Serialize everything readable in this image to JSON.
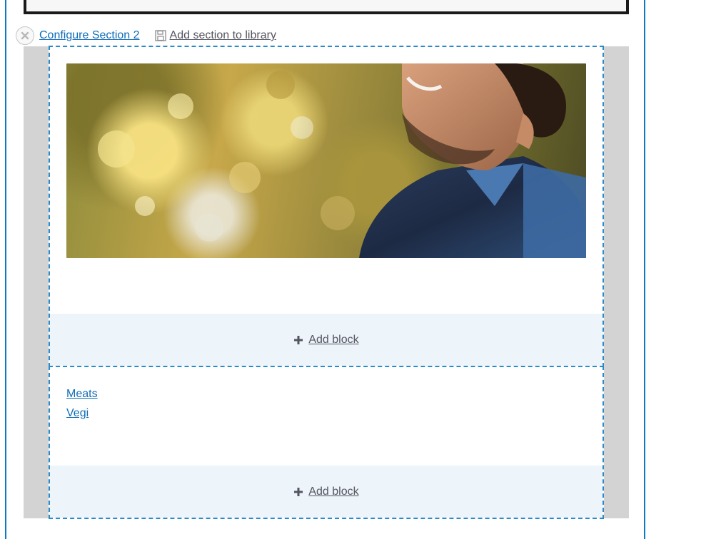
{
  "toolbar": {
    "remove_icon": "close-icon",
    "configure_label": "Configure Section 2",
    "library_icon": "save-icon",
    "library_label": "Add section to library"
  },
  "region_1": {
    "image_alt": "Smiling man with curly hair wearing a navy puffer vest, autumn trees in background",
    "add_block_label": "Add block"
  },
  "region_2": {
    "links": [
      "Meats",
      "Vegi"
    ],
    "add_block_label": "Add block"
  },
  "colors": {
    "accent": "#0f7bbf",
    "link": "#0f6cb6",
    "region_border": "#2d8ac9",
    "add_block_bg": "#edf4fa",
    "section_bg": "#d3d3d3"
  }
}
